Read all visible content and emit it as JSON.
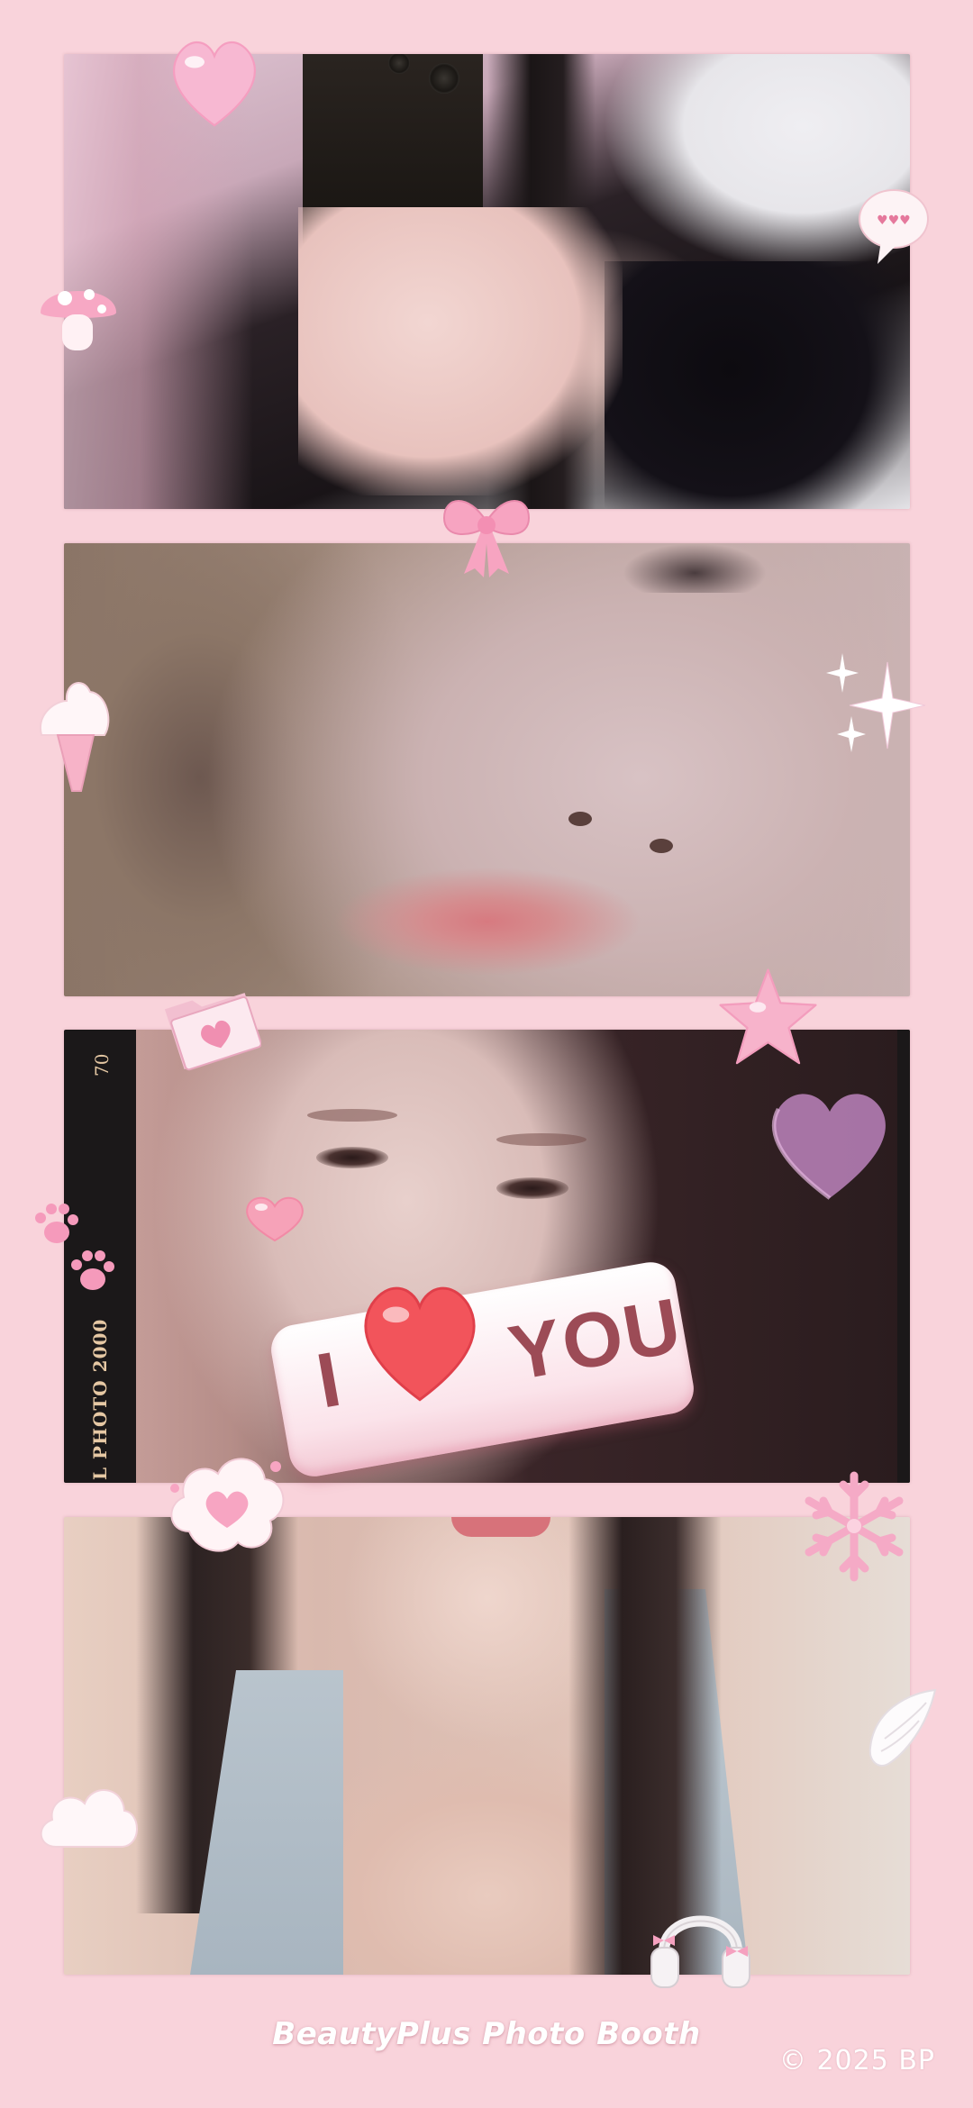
{
  "branding": {
    "label": "BeautyPlus Photo Booth",
    "copyright": "© 2025 BP"
  },
  "photos": [
    {
      "name": "mirror-selfie-photo"
    },
    {
      "name": "closeup-face-photo"
    },
    {
      "name": "smiling-face-photo"
    },
    {
      "name": "blue-top-photo"
    }
  ],
  "film_strip": {
    "frame_number": "70",
    "brand_text": "L PHOTO 2000"
  },
  "sticker_text": {
    "i": "I",
    "you": "YOU"
  },
  "colors": {
    "background": "#f9d3db",
    "accent_pink": "#f4a5bd",
    "heart_red": "#f2545b",
    "sticker_text": "#9c4b56"
  },
  "stickers": [
    "heart",
    "speech-bubble-hearts",
    "mushroom",
    "bow",
    "ice-cream",
    "sparkles",
    "folder-heart",
    "star",
    "paw-prints",
    "pink-heart",
    "bg-purple-heart",
    "i-love-you",
    "cloud-heart",
    "snowflake",
    "wing",
    "cloud",
    "headphones"
  ]
}
